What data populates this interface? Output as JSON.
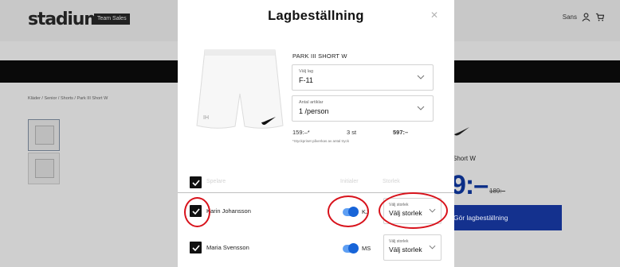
{
  "background": {
    "logo": "stadium",
    "logo_badge": "Team Sales",
    "header_search": "Sans",
    "breadcrumb": "Kläder / Senior / Shorts / Park III Short W",
    "product_name_partial": "Short W",
    "price_partial": "9:–",
    "old_price": "189:–",
    "cta_label": "Gör lagbeställning"
  },
  "modal": {
    "title": "Lagbeställning",
    "close_symbol": "✕",
    "product_name": "PARK III SHORT W",
    "team_field": {
      "label": "Välj lag",
      "value": "F-11"
    },
    "qty_field": {
      "label": "Antal artiklar",
      "value": "1 /person"
    },
    "price": {
      "unit": "159:–*",
      "count": "3 st",
      "total": "597:–"
    },
    "price_note": "*Styckpriset påverkas av antal tryck",
    "image_text": "IH",
    "columns": {
      "players": "Spelare",
      "initials": "Initialer",
      "size": "Storlek"
    },
    "players": [
      {
        "name": "Karin Johansson",
        "initials": "KJ",
        "size_label": "Välj storlek",
        "size_value": "Välj storlek",
        "checked": true,
        "initials_on": true
      },
      {
        "name": "Maria Svensson",
        "initials": "MS",
        "size_label": "Välj storlek",
        "size_value": "Välj storlek",
        "checked": true,
        "initials_on": true
      }
    ]
  },
  "colors": {
    "annotation": "#d8121b",
    "toggle": "#1764d8",
    "cta": "#14318e",
    "price": "#0b2e87"
  }
}
